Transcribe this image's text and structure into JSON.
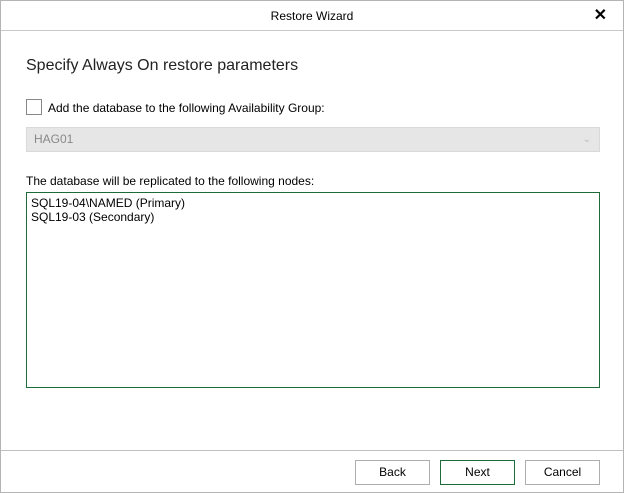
{
  "window": {
    "title": "Restore Wizard",
    "close_icon": "close-icon"
  },
  "page": {
    "heading": "Specify Always On restore parameters",
    "add_to_ag": {
      "label": "Add the database to the following Availability Group:",
      "checked": false
    },
    "availability_group": {
      "value": "HAG01",
      "enabled": false
    },
    "nodes_label": "The database will be replicated to the following nodes:",
    "nodes": [
      "SQL19-04\\NAMED (Primary)",
      "SQL19-03 (Secondary)"
    ]
  },
  "footer": {
    "back": "Back",
    "next": "Next",
    "cancel": "Cancel"
  },
  "colors": {
    "accent": "#1e6b3a",
    "disabled_bg": "#e6e6e6"
  }
}
